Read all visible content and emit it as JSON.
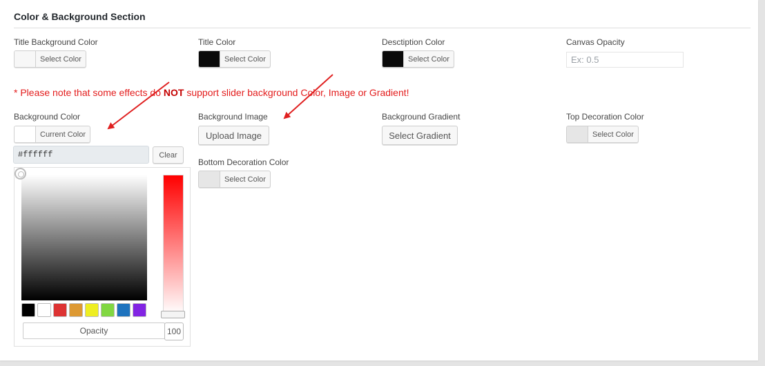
{
  "section": {
    "title": "Color & Background Section"
  },
  "fields": {
    "title_bg": {
      "label": "Title Background Color",
      "button": "Select Color",
      "swatch": "#f7f7f7"
    },
    "title_color": {
      "label": "Title Color",
      "button": "Select Color",
      "swatch": "#0a0a0a"
    },
    "desc_color": {
      "label": "Desctiption Color",
      "button": "Select Color",
      "swatch": "#0a0a0a"
    },
    "canvas_opacity": {
      "label": "Canvas Opacity",
      "placeholder": "Ex: 0.5"
    },
    "bg_color": {
      "label": "Background Color",
      "button": "Current Color",
      "swatch": "#ffffff"
    },
    "bg_image": {
      "label": "Background Image",
      "button": "Upload Image"
    },
    "bg_gradient": {
      "label": "Background Gradient",
      "button": "Select Gradient"
    },
    "top_deco": {
      "label": "Top Decoration Color",
      "button": "Select Color",
      "swatch": "#e6e6e6"
    },
    "bottom_deco": {
      "label": "Bottom Decoration Color",
      "button": "Select Color",
      "swatch": "#e6e6e6"
    }
  },
  "notice": {
    "before": "* Please note that some effects do ",
    "strong": "NOT",
    "after": " support slider background Color, Image or Gradient!"
  },
  "picker": {
    "hex_value": "#ffffff",
    "clear_label": "Clear",
    "opacity_label": "Opacity",
    "opacity_value": "100",
    "hue_color": "#ff0000",
    "palette": [
      "#000000",
      "#ffffff",
      "#dd3333",
      "#dd9933",
      "#eeee22",
      "#81d742",
      "#1e73be",
      "#8224e3"
    ]
  },
  "colors": {
    "notice": "#e31b1b",
    "arrow": "#e02020"
  }
}
